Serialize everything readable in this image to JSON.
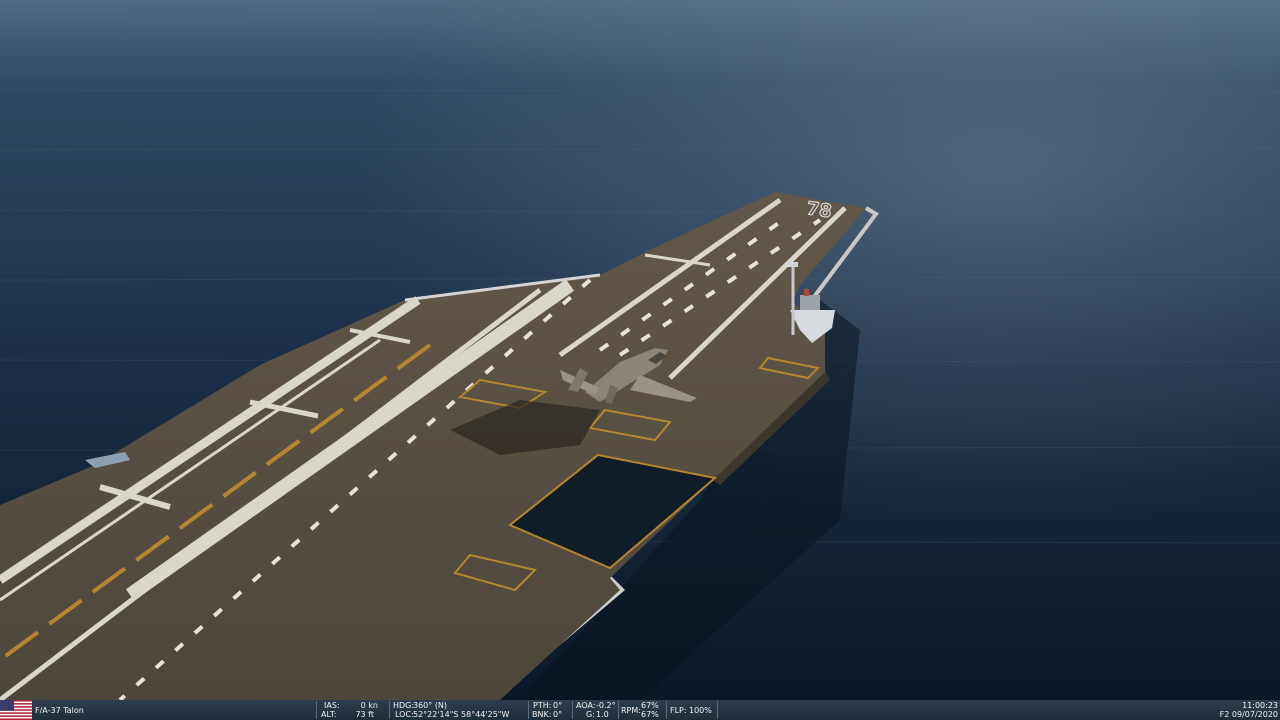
{
  "scene": {
    "hull_number": "78"
  },
  "hud": {
    "aircraft": "F/A-37 Talon",
    "ias_label": "IAS:",
    "ias_value": "0 kn",
    "alt_label": "ALT:",
    "alt_value": "73 ft",
    "hdg_label": "HDG:",
    "hdg_value": "360° (N)",
    "loc_label": "LOC:",
    "loc_value": "52°22'14\"S 58°44'25\"W",
    "pth_label": "PTH:",
    "pth_value": "0°",
    "bnk_label": "BNK:",
    "bnk_value": "0°",
    "aoa_label": "AOA:",
    "aoa_value": "-0.2°",
    "g_label": "G:",
    "g_value": "1.0",
    "rpm_label": "RPM:",
    "rpm_value_1": "67%",
    "rpm_value_2": "67%",
    "flp_label": "FLP:",
    "flp_value": "100%",
    "time": "11:00:23",
    "date": "F2 09/07/2020"
  },
  "colors": {
    "sea_top": "#2f4a63",
    "sea_bottom": "#0a1a2a",
    "deck": "#564d40",
    "deck_marking": "#d9d6cc",
    "foul_line": "#b6862f",
    "hud_bar": "#2d3e50"
  },
  "icons": [
    "us-flag-icon"
  ]
}
